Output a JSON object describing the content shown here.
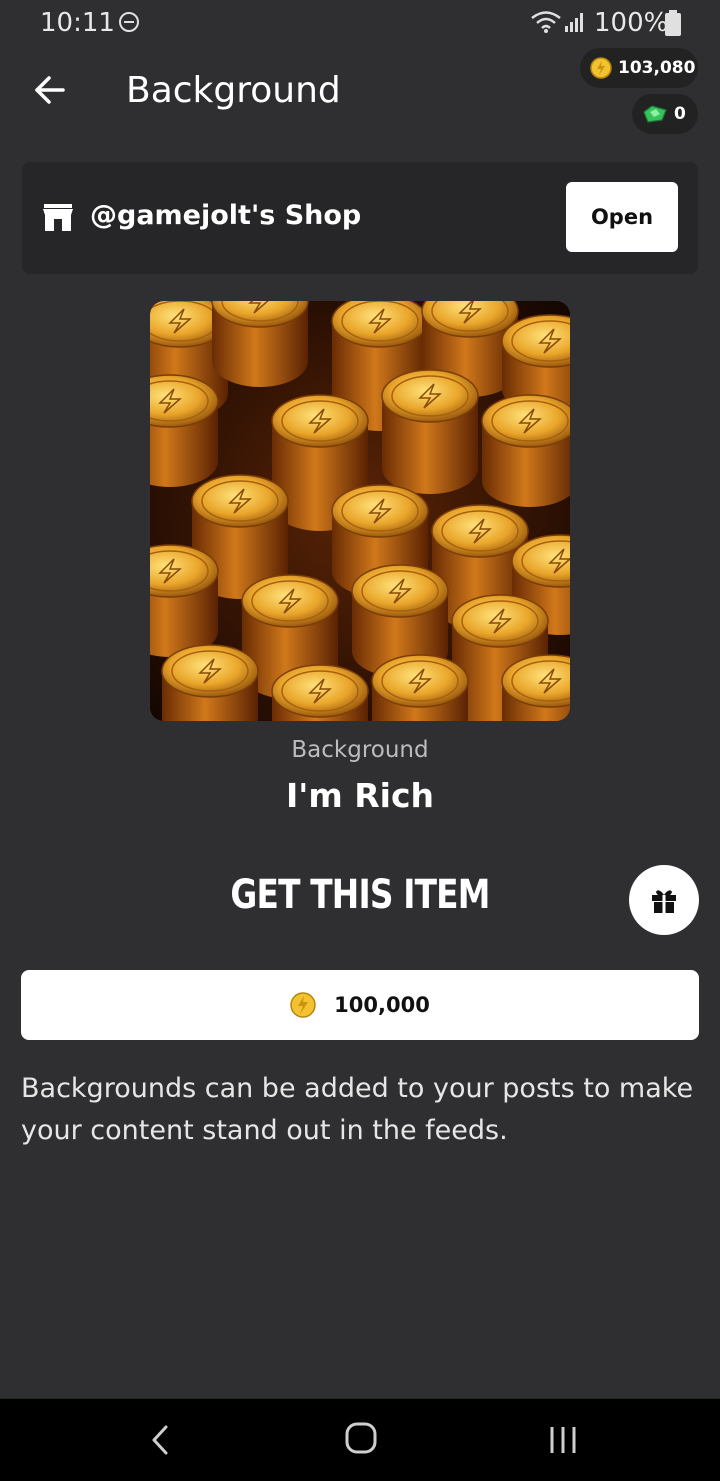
{
  "status_bar": {
    "time": "10:11",
    "battery": "100%"
  },
  "header": {
    "title": "Background",
    "coins": "103,080",
    "gems": "0"
  },
  "shop": {
    "name": "@gamejolt's Shop",
    "open_label": "Open"
  },
  "item": {
    "type": "Background",
    "name": "I'm Rich"
  },
  "purchase": {
    "heading": "GET THIS ITEM",
    "price": "100,000"
  },
  "description": "Backgrounds can be added to your posts to make your content stand out in the feeds.",
  "colors": {
    "background": "#2f2e30",
    "card": "#262527",
    "coin": "#f2c230",
    "gem": "#37c25a"
  }
}
